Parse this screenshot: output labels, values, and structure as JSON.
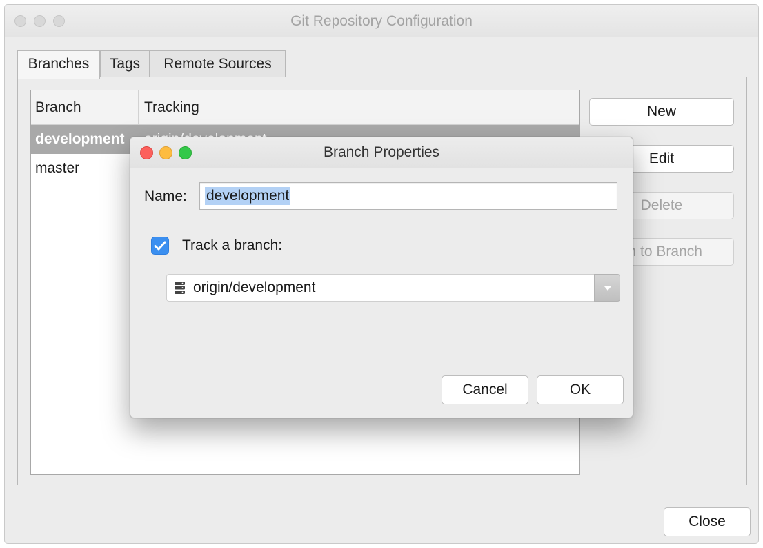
{
  "window": {
    "title": "Git Repository Configuration"
  },
  "tabs": [
    {
      "label": "Branches",
      "active": true
    },
    {
      "label": "Tags",
      "active": false
    },
    {
      "label": "Remote Sources",
      "active": false
    }
  ],
  "branch_table": {
    "columns": [
      "Branch",
      "Tracking"
    ],
    "rows": [
      {
        "branch": "development",
        "tracking": "origin/development",
        "selected": true
      },
      {
        "branch": "master",
        "tracking": "",
        "selected": false
      }
    ]
  },
  "side_buttons": {
    "new": "New",
    "edit": "Edit",
    "delete": "Delete",
    "switch_visible": "ch to Branch"
  },
  "close_button": "Close",
  "dialog": {
    "title": "Branch Properties",
    "name_label": "Name:",
    "name_value": "development",
    "track_checked": true,
    "track_label": "Track a branch:",
    "tracked_branch": "origin/development",
    "tracked_branch_icon": "database-icon",
    "cancel": "Cancel",
    "ok": "OK"
  },
  "colors": {
    "selection_row": "#a9a9a9",
    "text_selection": "#b3d1f5",
    "checkbox": "#3b8ff0",
    "close_light": "#fc605c",
    "minimize_light": "#fdbc40",
    "zoom_light": "#34c84a"
  }
}
